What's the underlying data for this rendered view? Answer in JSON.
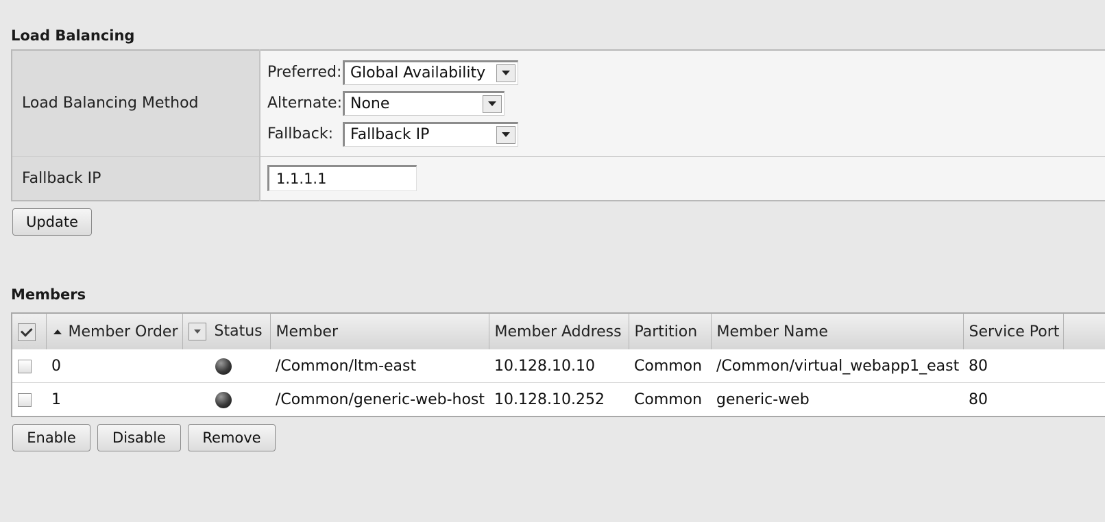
{
  "load_balancing": {
    "section_title": "Load Balancing",
    "method_label": "Load Balancing Method",
    "preferred_label": "Preferred:",
    "preferred_value": "Global Availability",
    "alternate_label": "Alternate:",
    "alternate_value": "None",
    "fallback_label": "Fallback:",
    "fallback_value": "Fallback IP",
    "fallback_ip_label": "Fallback IP",
    "fallback_ip_value": "1.1.1.1",
    "update_button": "Update"
  },
  "members": {
    "section_title": "Members",
    "columns": [
      "Member Order",
      "Status",
      "Member",
      "Member Address",
      "Partition",
      "Member Name",
      "Service Port"
    ],
    "rows": [
      {
        "order": "0",
        "member": "/Common/ltm-east",
        "address": "10.128.10.10",
        "partition": "Common",
        "name": "/Common/virtual_webapp1_east",
        "port": "80"
      },
      {
        "order": "1",
        "member": "/Common/generic-web-host",
        "address": "10.128.10.252",
        "partition": "Common",
        "name": "generic-web",
        "port": "80"
      }
    ],
    "buttons": {
      "enable": "Enable",
      "disable": "Disable",
      "remove": "Remove"
    }
  },
  "colors": {
    "link": "#2f55c8",
    "background": "#e8e8e8"
  }
}
